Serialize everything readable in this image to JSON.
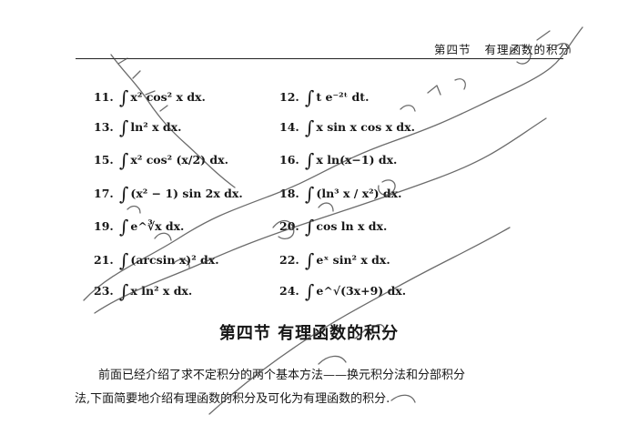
{
  "header": {
    "section_label": "第四节",
    "section_name": "有理函数的积分"
  },
  "exercises": [
    {
      "num": "11.",
      "expr": "x² cos² x dx."
    },
    {
      "num": "12.",
      "expr": "t e⁻²ᵗ dt."
    },
    {
      "num": "13.",
      "expr": "ln² x dx."
    },
    {
      "num": "14.",
      "expr": "x sin x cos x dx."
    },
    {
      "num": "15.",
      "expr": "x² cos² (x/2) dx."
    },
    {
      "num": "16.",
      "expr": "x ln(x−1) dx."
    },
    {
      "num": "17.",
      "expr": "(x² − 1) sin 2x dx."
    },
    {
      "num": "18.",
      "expr": "(ln³ x / x²) dx."
    },
    {
      "num": "19.",
      "expr": "e^∛x dx."
    },
    {
      "num": "20.",
      "expr": "cos ln x dx."
    },
    {
      "num": "21.",
      "expr": "(arcsin x)² dx."
    },
    {
      "num": "22.",
      "expr": "eˣ sin² x dx."
    },
    {
      "num": "23.",
      "expr": "x ln² x dx."
    },
    {
      "num": "24.",
      "expr": "e^√(3x+9) dx."
    }
  ],
  "section": {
    "title": "第四节  有理函数的积分"
  },
  "paragraph": {
    "line1": "前面已经介绍了求不定积分的两个基本方法——换元积分法和分部积分",
    "line2": "法,下面简要地介绍有理函数的积分及可化为有理函数的积分."
  }
}
